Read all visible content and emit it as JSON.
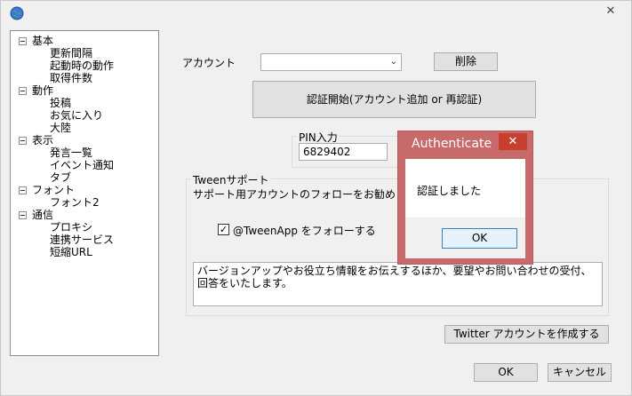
{
  "window": {
    "close_glyph": "✕",
    "app_icon": "globe-icon"
  },
  "tree": {
    "groups": [
      {
        "label": "基本",
        "children": [
          "更新間隔",
          "起動時の動作",
          "取得件数"
        ]
      },
      {
        "label": "動作",
        "children": [
          "投稿",
          "お気に入り",
          "大陸"
        ]
      },
      {
        "label": "表示",
        "children": [
          "発言一覧",
          "イベント通知",
          "タブ"
        ]
      },
      {
        "label": "フォント",
        "children": [
          "フォント2"
        ]
      },
      {
        "label": "通信",
        "children": [
          "プロキシ",
          "連携サービス",
          "短縮URL"
        ]
      }
    ]
  },
  "account": {
    "label": "アカウント",
    "combo_value": "",
    "delete_label": "削除",
    "auth_button_label": "認証開始(アカウント追加 or 再認証)"
  },
  "pin": {
    "group_title": "PIN入力",
    "value": "6829402"
  },
  "support": {
    "group_title": "Tweenサポート",
    "description": "サポート用アカウントのフォローをお勧めしています。",
    "follow_checkbox_label": "@TweenApp をフォローする",
    "follow_checked": true,
    "info_text": "バージョンアップやお役立ち情報をお伝えするほか、要望やお問い合わせの受付、回答をいたします。"
  },
  "create_account_label": "Twitter アカウントを作成する",
  "footer": {
    "ok_label": "OK",
    "cancel_label": "キャンセル"
  },
  "dialog": {
    "title": "Authenticate",
    "message": "認証しました",
    "ok_label": "OK",
    "close_glyph": "✕"
  },
  "colors": {
    "dialog_frame": "#c86a6a",
    "dialog_close": "#c7402f",
    "window_bg": "#f0f0f0"
  }
}
